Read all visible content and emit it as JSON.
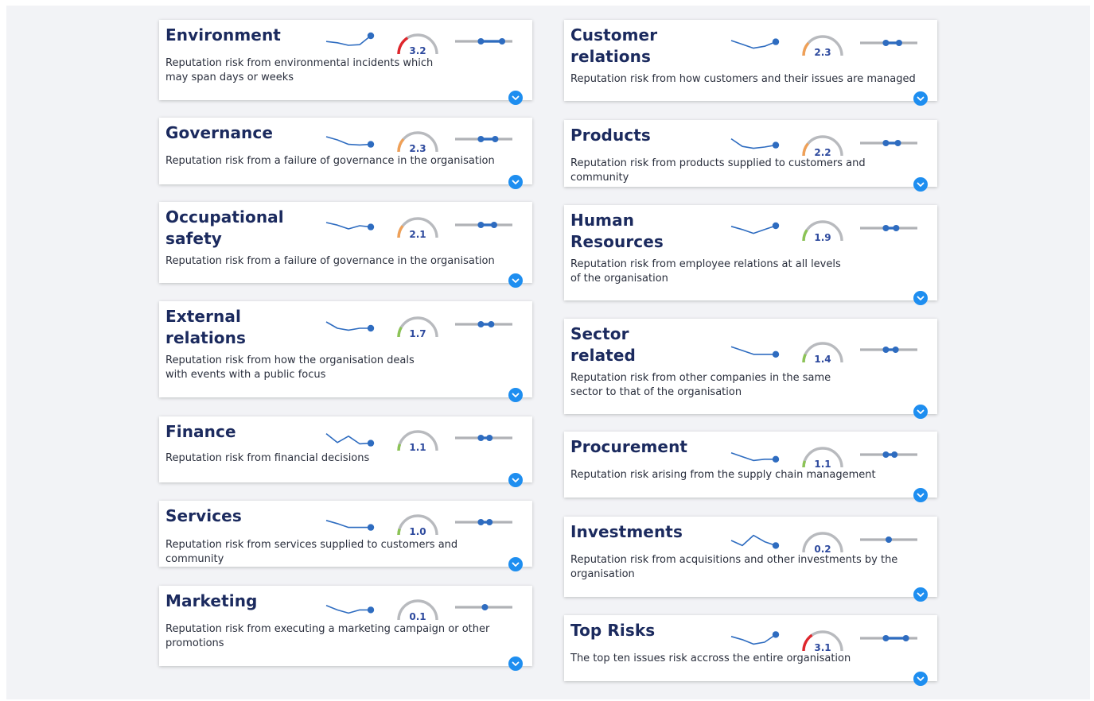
{
  "colors": {
    "title": "#1b2a5e",
    "accent_blue": "#2e6cc0",
    "range_grey": "#b0b2b6",
    "gauge_track": "#b8babe",
    "expand_blue": "#1e8ef0",
    "gauge_high": "#e0262c",
    "gauge_medium": "#f0a056",
    "gauge_low": "#8cc455"
  },
  "cards": [
    {
      "id": "environment",
      "title": "Environment",
      "description": "Reputation risk from environmental incidents which may span days or weeks",
      "score": "3.2",
      "score_value": 3.2,
      "level": "high",
      "trend": [
        0.45,
        0.55,
        0.75,
        0.7,
        0.0
      ],
      "range": [
        0.45,
        0.82
      ]
    },
    {
      "id": "governance",
      "title": "Governance",
      "description": "Reputation risk from a failure of governance in the organisation",
      "score": "2.3",
      "score_value": 2.3,
      "level": "medium",
      "trend": [
        0.25,
        0.5,
        0.85,
        0.9,
        0.85
      ],
      "range": [
        0.45,
        0.7
      ]
    },
    {
      "id": "occupational-safety",
      "title": "Occupational safety",
      "description": "Reputation risk from a failure of governance in the organisation",
      "score": "2.1",
      "score_value": 2.1,
      "level": "medium",
      "trend": [
        0.25,
        0.45,
        0.75,
        0.5,
        0.6
      ],
      "range": [
        0.45,
        0.68
      ]
    },
    {
      "id": "external-relations",
      "title": "External relations",
      "description": "Reputation risk from how the organisation deals with events with a public focus",
      "score": "1.7",
      "score_value": 1.7,
      "level": "low",
      "trend": [
        0.25,
        0.75,
        0.9,
        0.75,
        0.75
      ],
      "range": [
        0.45,
        0.63
      ]
    },
    {
      "id": "finance",
      "title": "Finance",
      "description": "Reputation risk from financial decisions",
      "score": "1.1",
      "score_value": 1.1,
      "level": "low",
      "trend": [
        0.1,
        0.8,
        0.3,
        0.9,
        0.85
      ],
      "range": [
        0.45,
        0.6
      ]
    },
    {
      "id": "services",
      "title": "Services",
      "description": "Reputation risk from services supplied to customers and community",
      "score": "1.0",
      "score_value": 1.0,
      "level": "low",
      "trend": [
        0.3,
        0.55,
        0.85,
        0.85,
        0.85
      ],
      "range": [
        0.45,
        0.6
      ]
    },
    {
      "id": "marketing",
      "title": "Marketing",
      "description": "Reputation risk from executing a marketing campaign or other promotions",
      "score": "0.1",
      "score_value": 0.1,
      "level": "none",
      "trend": [
        0.3,
        0.65,
        0.9,
        0.65,
        0.65
      ],
      "range": [
        0.52,
        0.52
      ]
    },
    {
      "id": "customer-relations",
      "title": "Customer relations",
      "description": "Reputation risk from how customers and their issues are managed",
      "score": "2.3",
      "score_value": 2.3,
      "level": "medium",
      "trend": [
        0.25,
        0.55,
        0.85,
        0.7,
        0.35
      ],
      "range": [
        0.45,
        0.68
      ]
    },
    {
      "id": "products",
      "title": "Products",
      "description": "Reputation risk from products supplied to customers and community",
      "score": "2.2",
      "score_value": 2.2,
      "level": "medium",
      "trend": [
        0.1,
        0.7,
        0.85,
        0.75,
        0.6
      ],
      "range": [
        0.45,
        0.66
      ]
    },
    {
      "id": "human-resources",
      "title": "Human Resources",
      "description": "Reputation risk from employee relations at all levels of the organisation",
      "score": "1.9",
      "score_value": 1.9,
      "level": "low",
      "trend": [
        0.3,
        0.55,
        0.85,
        0.55,
        0.25
      ],
      "range": [
        0.45,
        0.63
      ]
    },
    {
      "id": "sector-related",
      "title": "Sector related",
      "description": "Reputation risk from other companies in the same sector to that of the organisation",
      "score": "1.4",
      "score_value": 1.4,
      "level": "low",
      "trend": [
        0.2,
        0.5,
        0.8,
        0.8,
        0.8
      ],
      "range": [
        0.45,
        0.62
      ]
    },
    {
      "id": "procurement",
      "title": "Procurement",
      "description": "Reputation risk arising from the supply chain management",
      "score": "1.1",
      "score_value": 1.1,
      "level": "low",
      "trend": [
        0.3,
        0.6,
        0.9,
        0.8,
        0.8
      ],
      "range": [
        0.45,
        0.6
      ]
    },
    {
      "id": "investments",
      "title": "Investments",
      "description": "Reputation risk from acquisitions and other investments by the organisation",
      "score": "0.2",
      "score_value": 0.2,
      "level": "none",
      "trend": [
        0.5,
        0.9,
        0.1,
        0.6,
        0.9
      ],
      "range": [
        0.5,
        0.5
      ]
    },
    {
      "id": "top-risks",
      "title": "Top Risks",
      "description": "The top ten issues risk accross the entire organisation",
      "score": "3.1",
      "score_value": 3.1,
      "level": "high",
      "trend": [
        0.3,
        0.55,
        0.9,
        0.75,
        0.15
      ],
      "range": [
        0.45,
        0.8
      ]
    }
  ]
}
